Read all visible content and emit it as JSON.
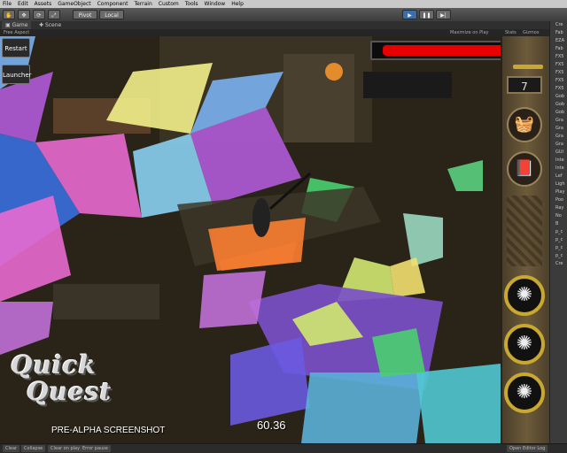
{
  "menu": [
    "File",
    "Edit",
    "Assets",
    "GameObject",
    "Component",
    "Terrain",
    "Custom",
    "Tools",
    "Window",
    "Help"
  ],
  "toolbar": {
    "pivot_label": "Pivot",
    "local_label": "Local",
    "play_icon": "play-icon",
    "pause_icon": "pause-icon",
    "step_icon": "step-icon"
  },
  "tabs": {
    "game": "Game",
    "scene": "Scene"
  },
  "game_bar": {
    "aspect": "Free Aspect",
    "maximize": "Maximize on Play",
    "stats": "Stats",
    "gizmos": "Gizmos"
  },
  "hud": {
    "restart_label": "Restart",
    "launcher_label": "Launcher",
    "level": "7",
    "health_fraction": 0.93,
    "fps": "60.36",
    "caption": "PRE-ALPHA SCREENSHOT",
    "logo_line1": "Quick",
    "logo_line2": "Quest",
    "health_color": "#e60000",
    "ability_ring_color": "#c8a830"
  },
  "inspector": {
    "header": "Create",
    "items": [
      "Cre",
      "Fab",
      "EZA",
      "Fab",
      "FX5",
      "FX5",
      "FX5",
      "FX5",
      "FX5",
      "Gob",
      "Gob",
      "Gob",
      "Gra",
      "Gra",
      "Gra",
      "Gra",
      "GUI",
      "Inte",
      "Inte",
      "Lef",
      "Ligh",
      "Play",
      "Poo",
      "Ray",
      "No",
      "B",
      "p_c",
      "p_c",
      "p_c",
      "p_c",
      "Cre"
    ]
  },
  "statusbar": {
    "clear": "Clear",
    "collapse": "Collapse",
    "clear_on_play": "Clear on play",
    "error_pause": "Error pause",
    "open_log": "Open Editor Log"
  }
}
